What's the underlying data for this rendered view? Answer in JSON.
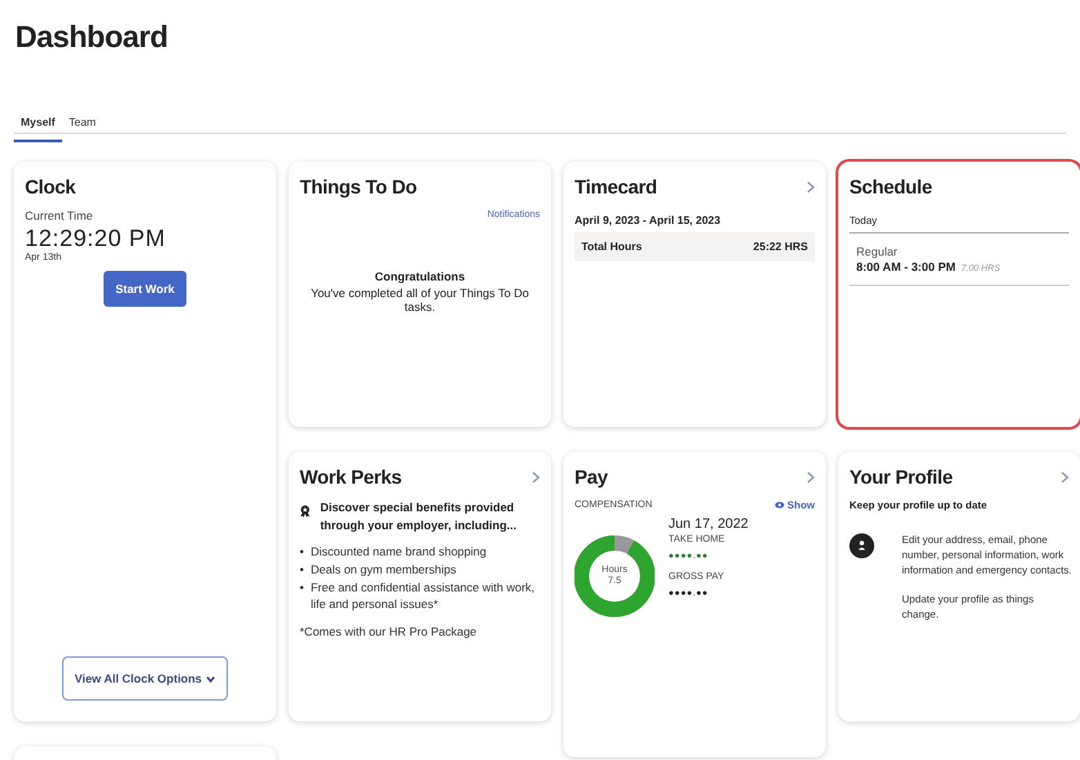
{
  "page": {
    "title": "Dashboard"
  },
  "tabs": [
    {
      "label": "Myself",
      "selected": true
    },
    {
      "label": "Team",
      "selected": false
    }
  ],
  "clock": {
    "title": "Clock",
    "label": "Current Time",
    "time": "12:29:20 PM",
    "date": "Apr 13th",
    "start_button": "Start Work",
    "options_button": "View All Clock Options"
  },
  "things_to_do": {
    "title": "Things To Do",
    "link": "Notifications",
    "heading": "Congratulations",
    "message": "You've completed all of your Things To Do tasks."
  },
  "timecard": {
    "title": "Timecard",
    "period": "April 9, 2023 - April 15, 2023",
    "total_label": "Total Hours",
    "total_value": "25:22 HRS"
  },
  "schedule": {
    "title": "Schedule",
    "highlighted": true,
    "day": "Today",
    "shift_type": "Regular",
    "shift_time": "8:00 AM - 3:00 PM",
    "shift_hours": "7.00 HRS"
  },
  "work_perks": {
    "title": "Work Perks",
    "intro": "Discover special benefits provided through your employer, including...",
    "items": [
      {
        "bullet": "•",
        "text": "Discounted name brand shopping"
      },
      {
        "bullet": "•",
        "text": "Deals on gym memberships"
      },
      {
        "bullet": "•",
        "text": "Free and confidential assistance with work, life and personal issues*"
      }
    ],
    "footnote": "*Comes with our HR Pro Package"
  },
  "pay": {
    "title": "Pay",
    "section": "COMPENSATION",
    "show_link": "Show",
    "donut_label": "Hours",
    "donut_value": "7.5",
    "date": "Jun 17, 2022",
    "take_home_label": "TAKE HOME",
    "take_home_value": "●●●●.●●",
    "gross_label": "GROSS PAY",
    "gross_value": "●●●●.●●"
  },
  "profile": {
    "title": "Your Profile",
    "subtitle": "Keep your profile up to date",
    "text": "Edit your address, email, phone number, personal information, work information and emergency contacts.",
    "note": "Update your profile as things change."
  }
}
